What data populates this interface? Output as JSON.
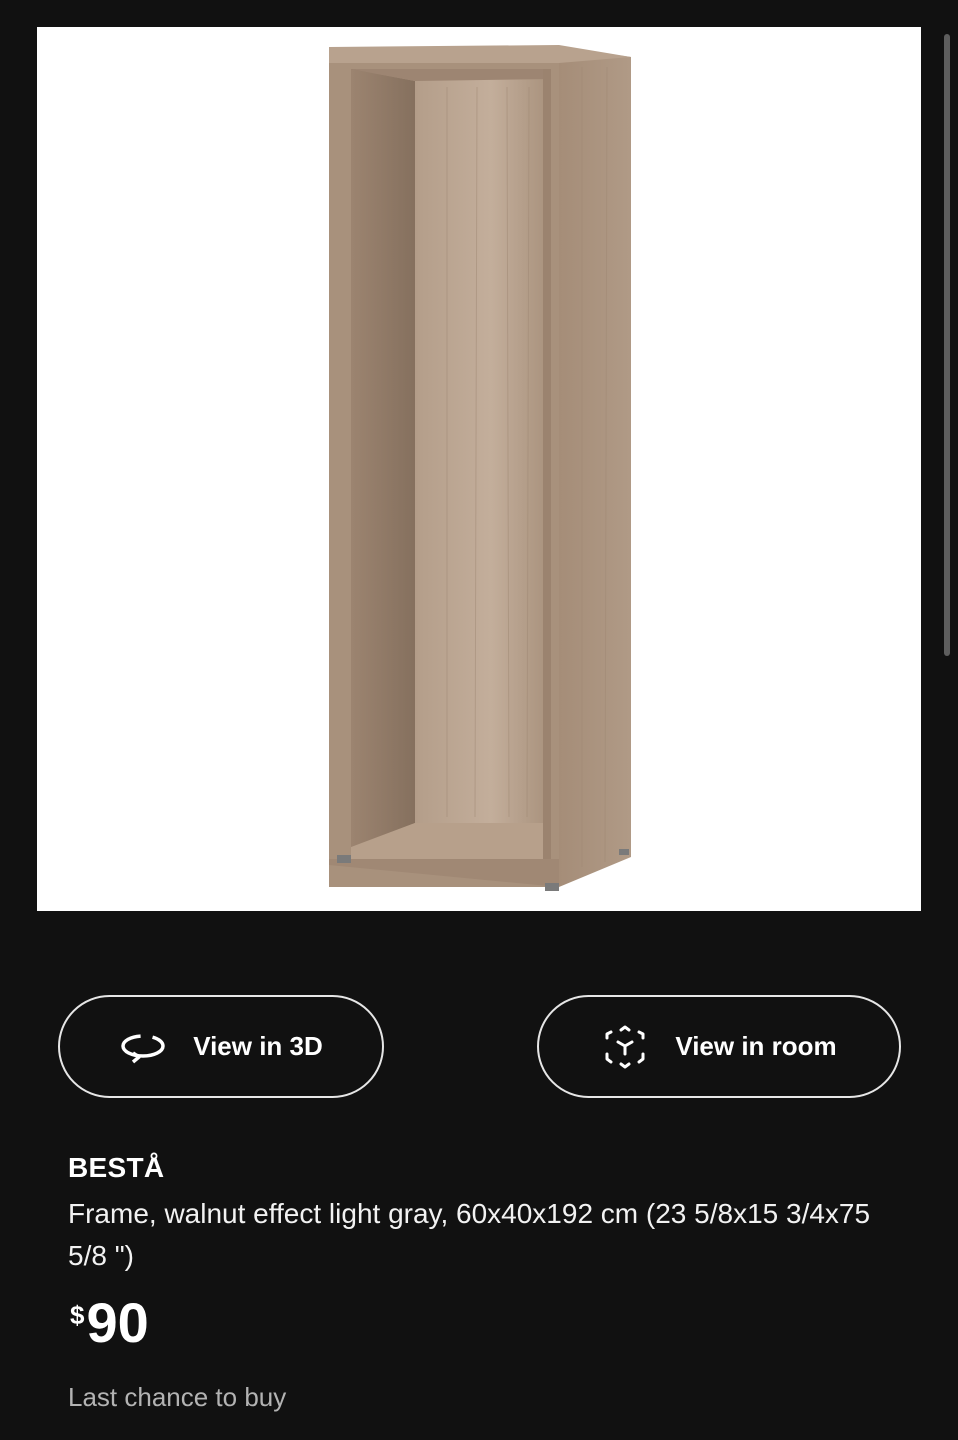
{
  "product": {
    "image_alt": "BESTÅ frame, walnut effect light gray",
    "name": "BESTÅ",
    "description": "Frame, walnut effect light gray, 60x40x192 cm (23 5/8x15 3/4x75 5/8 \")",
    "price_currency": "$",
    "price_amount": "90",
    "availability": "Last chance to buy"
  },
  "actions": {
    "view_3d_label": "View in 3D",
    "view_room_label": "View in room"
  },
  "icons": {
    "view_3d": "rotate-3d-icon",
    "view_room": "ar-cube-icon"
  },
  "colors": {
    "background": "#111111",
    "text": "#ffffff",
    "muted_text": "#b3b3b3",
    "button_border": "#e6e6e6",
    "wood": "#a58d78"
  }
}
